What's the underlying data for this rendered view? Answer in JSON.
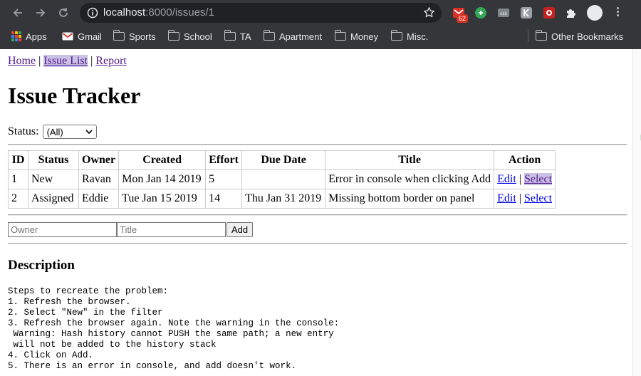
{
  "browser": {
    "url_host": "localhost",
    "url_path": ":8000/issues/1",
    "gmail_badge": "62",
    "bookmarks": [
      {
        "label": "Apps",
        "icon": "apps-icon"
      },
      {
        "label": "Gmail",
        "icon": "gmail-icon"
      },
      {
        "label": "Sports",
        "icon": "folder-icon"
      },
      {
        "label": "School",
        "icon": "folder-icon"
      },
      {
        "label": "TA",
        "icon": "folder-icon"
      },
      {
        "label": "Apartment",
        "icon": "folder-icon"
      },
      {
        "label": "Money",
        "icon": "folder-icon"
      },
      {
        "label": "Misc.",
        "icon": "folder-icon"
      }
    ],
    "other_bookmarks": "Other Bookmarks"
  },
  "nav": {
    "home": "Home",
    "sep": "|",
    "issue_list": "Issue List",
    "report": "Report"
  },
  "page_title": "Issue Tracker",
  "filter": {
    "label": "Status:",
    "selected": "(All)"
  },
  "table": {
    "headers": [
      "ID",
      "Status",
      "Owner",
      "Created",
      "Effort",
      "Due Date",
      "Title",
      "Action"
    ],
    "rows": [
      {
        "id": "1",
        "status": "New",
        "owner": "Ravan",
        "created": "Mon Jan 14 2019",
        "effort": "5",
        "due": "",
        "title": "Error in console when clicking Add",
        "edit": "Edit",
        "sep": "|",
        "select": "Select"
      },
      {
        "id": "2",
        "status": "Assigned",
        "owner": "Eddie",
        "created": "Tue Jan 15 2019",
        "effort": "14",
        "due": "Thu Jan 31 2019",
        "title": "Missing bottom border on panel",
        "edit": "Edit",
        "sep": "|",
        "select": "Select"
      }
    ]
  },
  "add_form": {
    "owner_placeholder": "Owner",
    "title_placeholder": "Title",
    "add_label": "Add"
  },
  "description": {
    "heading": "Description",
    "text": "Steps to recreate the problem:\n1. Refresh the browser.\n2. Select \"New\" in the filter\n3. Refresh the browser again. Note the warning in the console:\n Warning: Hash history cannot PUSH the same path; a new entry\n will not be added to the history stack\n4. Click on Add.\n5. There is an error in console, and add doesn't work."
  },
  "colors": {
    "chrome_bg": "#35363a",
    "visited_link": "#551a8b",
    "link": "#0000ee",
    "active_highlight": "#c9c2e6"
  }
}
